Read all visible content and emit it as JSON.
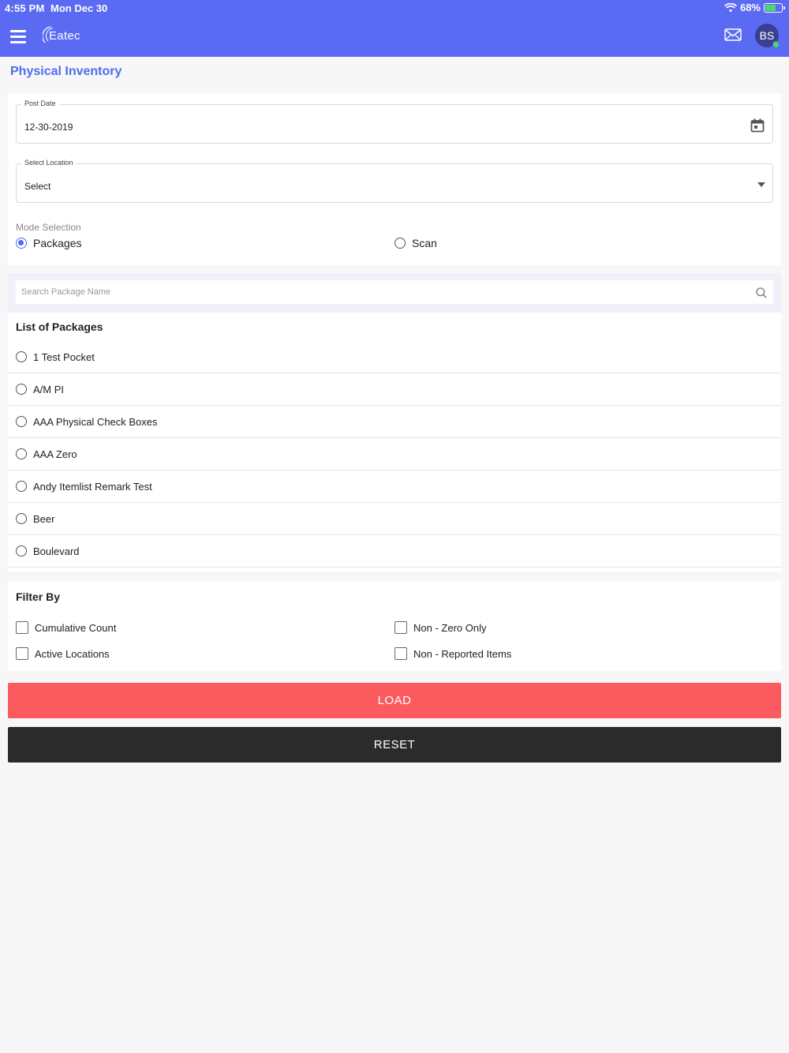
{
  "status_bar": {
    "time": "4:55 PM",
    "date": "Mon Dec 30",
    "battery": "68%",
    "battery_level": 0.68
  },
  "header": {
    "logo_text": "Eatec",
    "avatar_initials": "BS",
    "brand_color": "#5b6af3"
  },
  "page": {
    "title": "Physical Inventory"
  },
  "form": {
    "post_date_label": "Post Date",
    "post_date_value": "12-30-2019",
    "location_label": "Select Location",
    "location_value": "Select",
    "mode_label": "Mode Selection",
    "mode_options": [
      "Packages",
      "Scan"
    ],
    "mode_selected": "Packages"
  },
  "search": {
    "placeholder": "Search Package Name"
  },
  "packages": {
    "title": "List of Packages",
    "items": [
      "1 Test Pocket",
      "A/M PI",
      "AAA Physical Check Boxes",
      "AAA Zero",
      "Andy Itemlist Remark Test",
      "Beer",
      "Boulevard"
    ]
  },
  "filter": {
    "title": "Filter By",
    "options": [
      "Cumulative Count",
      "Non - Zero Only",
      "Active Locations",
      "Non - Reported Items"
    ]
  },
  "actions": {
    "load_label": "LOAD",
    "reset_label": "RESET",
    "load_color": "#fb5a5f",
    "reset_color": "#2b2b2b"
  },
  "icons": [
    "menu-icon",
    "calendar-icon",
    "dropdown-caret-icon",
    "search-icon",
    "mail-icon",
    "wifi-icon",
    "battery-icon"
  ]
}
